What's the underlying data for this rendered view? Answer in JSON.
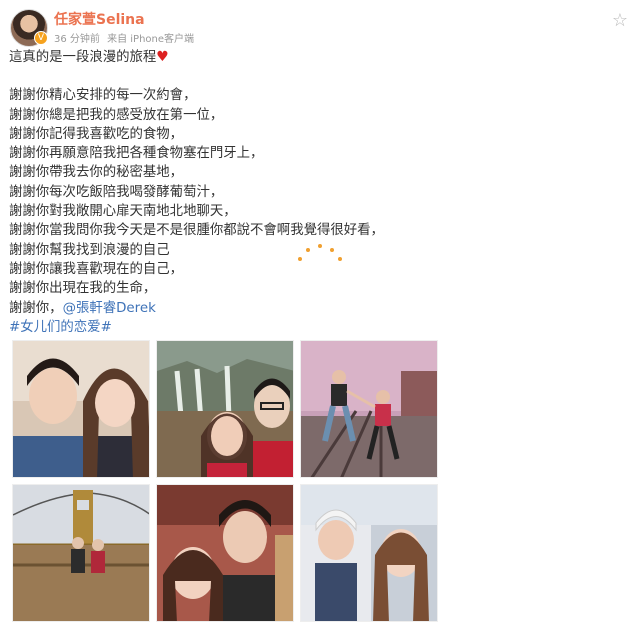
{
  "post": {
    "username": "任家萱Selina",
    "time": "36 分钟前",
    "source": "来自 iPhone客户端",
    "text_lines": [
      "這真的是一段浪漫的旅程",
      "謝謝你精心安排的每一次約會，",
      "謝謝你總是把我的感受放在第一位，",
      "謝謝你記得我喜歡吃的食物，",
      "謝謝你再願意陪我把各種食物塞在門牙上，",
      "謝謝你帶我去你的秘密基地，",
      "謝謝你每次吃飯陪我喝發酵葡萄汁，",
      "謝謝你對我敞開心扉天南地北地聊天，",
      "謝謝你當我問你我今天是不是很腫你都說不會啊我覺得很好看，",
      "謝謝你幫我找到浪漫的自己",
      "謝謝你讓我喜歡現在的自己，",
      "謝謝你出現在我的生命，",
      "謝謝你，"
    ],
    "mention": "@張軒睿Derek",
    "topic": "#女儿们的恋爱#"
  },
  "icons": {
    "favorite": "star-icon",
    "heart": "heart-icon",
    "verified": "verified-badge-icon"
  },
  "colors": {
    "username": "#eb7350",
    "link": "#3f73b8",
    "loader": "#f0a030"
  },
  "photos": [
    {
      "name": "photo-1"
    },
    {
      "name": "photo-2"
    },
    {
      "name": "photo-3"
    },
    {
      "name": "photo-4"
    },
    {
      "name": "photo-5"
    },
    {
      "name": "photo-6"
    }
  ]
}
